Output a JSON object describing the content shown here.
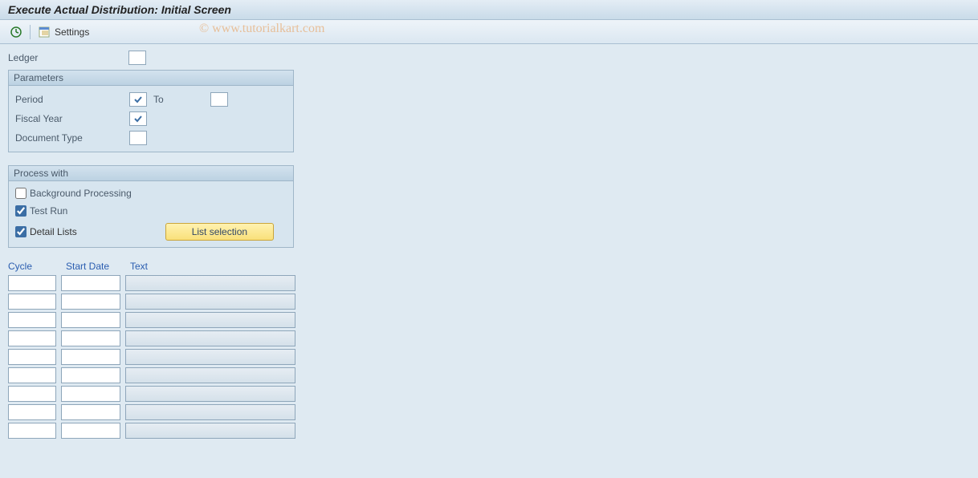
{
  "title": "Execute Actual Distribution: Initial Screen",
  "watermark": "© www.tutorialkart.com",
  "toolbar": {
    "settings_label": "Settings"
  },
  "ledger": {
    "label": "Ledger",
    "value": ""
  },
  "parameters": {
    "header": "Parameters",
    "period_label": "Period",
    "period_from": "",
    "to_label": "To",
    "period_to": "",
    "fiscal_year_label": "Fiscal Year",
    "fiscal_year": "",
    "doc_type_label": "Document Type",
    "doc_type": ""
  },
  "process": {
    "header": "Process with",
    "background_label": "Background Processing",
    "background_checked": false,
    "testrun_label": "Test Run",
    "testrun_checked": true,
    "detail_label": "Detail Lists",
    "detail_checked": true,
    "list_selection_label": "List selection"
  },
  "table": {
    "headers": {
      "cycle": "Cycle",
      "start": "Start Date",
      "text": "Text"
    },
    "rows": [
      {
        "cycle": "",
        "start": "",
        "text": ""
      },
      {
        "cycle": "",
        "start": "",
        "text": ""
      },
      {
        "cycle": "",
        "start": "",
        "text": ""
      },
      {
        "cycle": "",
        "start": "",
        "text": ""
      },
      {
        "cycle": "",
        "start": "",
        "text": ""
      },
      {
        "cycle": "",
        "start": "",
        "text": ""
      },
      {
        "cycle": "",
        "start": "",
        "text": ""
      },
      {
        "cycle": "",
        "start": "",
        "text": ""
      },
      {
        "cycle": "",
        "start": "",
        "text": ""
      }
    ]
  }
}
